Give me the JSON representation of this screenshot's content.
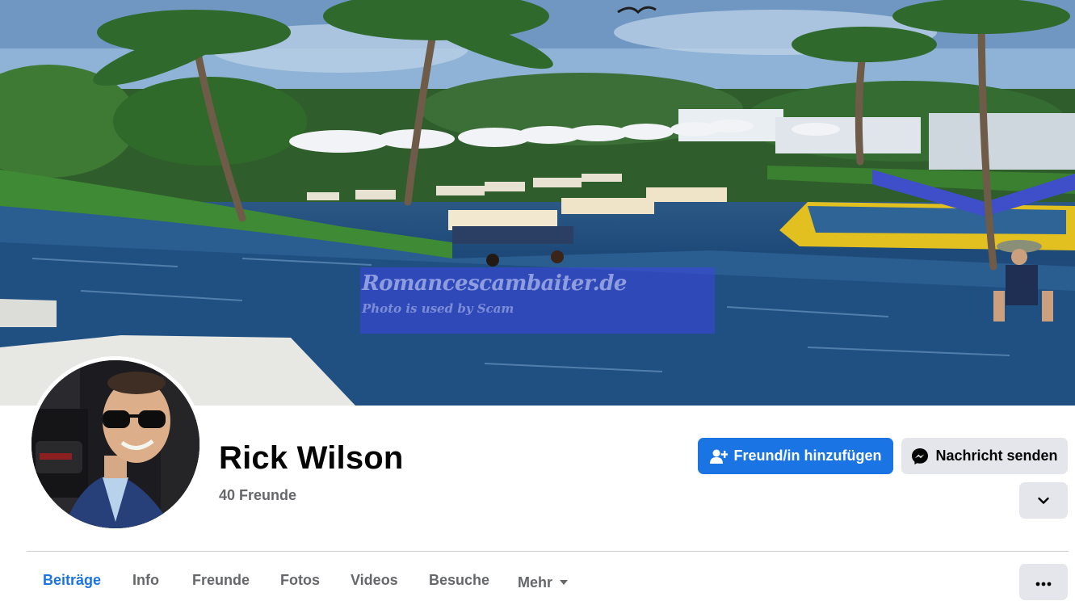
{
  "profile": {
    "name": "Rick Wilson",
    "friends_count": "40 Freunde"
  },
  "cover": {
    "watermark_line1": "Romancescambaiter.de",
    "watermark_line2": "Photo is used by Scam"
  },
  "actions": {
    "add_friend_label": "Freund/in hinzufügen",
    "message_label": "Nachricht senden"
  },
  "tabs": [
    {
      "label": "Beiträge",
      "active": true
    },
    {
      "label": "Info"
    },
    {
      "label": "Freunde"
    },
    {
      "label": "Fotos"
    },
    {
      "label": "Videos"
    },
    {
      "label": "Besuche"
    },
    {
      "label": "Mehr"
    }
  ],
  "icons": {
    "add_friend": "add-friend-icon",
    "messenger": "messenger-icon",
    "chevron": "chevron-down-icon",
    "caret": "caret-down-icon",
    "more": "more-dots-icon"
  },
  "colors": {
    "primary": "#1b74e4",
    "secondary_button": "#e4e6eb",
    "muted_text": "#65676b",
    "divider": "#ced0d4"
  }
}
